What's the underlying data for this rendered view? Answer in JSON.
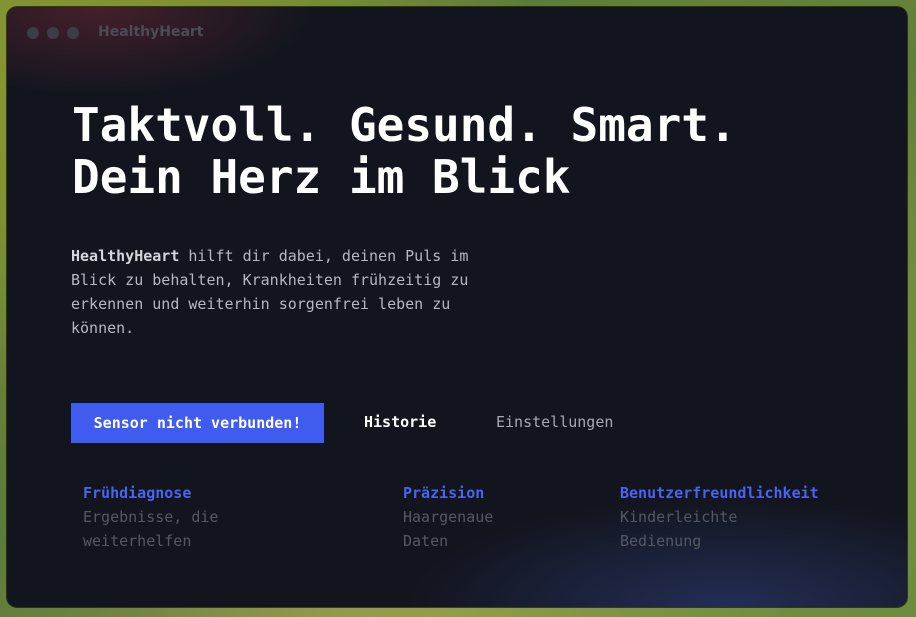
{
  "window": {
    "title": "HealthyHeart"
  },
  "hero": {
    "headline_line1": "Taktvoll. Gesund. Smart.",
    "headline_line2": "Dein Herz im Blick",
    "intro_brand": "HealthyHeart",
    "intro_text": " hilft dir dabei, deinen Puls im Blick zu behalten, Krankheiten frühzeitig zu erkennen und weiterhin sorgenfrei leben zu können."
  },
  "actions": {
    "sensor_button": "Sensor nicht verbunden!",
    "history_link": "Historie",
    "settings_link": "Einstellungen"
  },
  "features": [
    {
      "title": "Frühdiagnose",
      "description": "Ergebnisse, die\nweiterhelfen"
    },
    {
      "title": "Präzision",
      "description": "Haargenaue\nDaten"
    },
    {
      "title": "Benutzerfreundlichkeit",
      "description": "Kinderleichte\nBedienung"
    }
  ],
  "colors": {
    "accent": "#3f5bf0",
    "feature_title": "#4a63f0",
    "background": "#12151e"
  }
}
